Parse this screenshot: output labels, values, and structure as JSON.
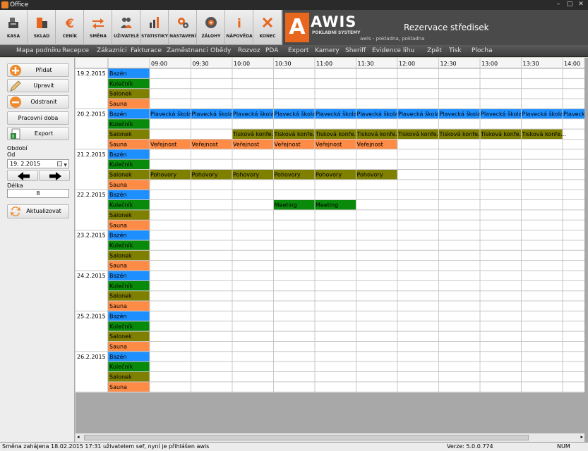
{
  "window": {
    "title": "Office"
  },
  "toolbar": [
    {
      "label": "KASA",
      "icon": "cash-register-icon"
    },
    {
      "label": "SKLAD",
      "icon": "warehouse-icon"
    },
    {
      "label": "CENÍK",
      "icon": "euro-icon"
    },
    {
      "label": "SMĚNA",
      "icon": "shift-arrows-icon"
    },
    {
      "label": "UŽIVATELÉ",
      "icon": "users-icon"
    },
    {
      "label": "STATISTIKY",
      "icon": "statistics-icon"
    },
    {
      "label": "NASTAVENÍ",
      "icon": "settings-icon"
    },
    {
      "label": "ZÁLOHY",
      "icon": "backup-icon"
    },
    {
      "label": "NÁPOVĚDA",
      "icon": "help-icon"
    },
    {
      "label": "KONEC",
      "icon": "close-icon"
    }
  ],
  "brand": {
    "name": "AWIS",
    "tagline": "POKLADNÍ SYSTÉMY",
    "page_title": "Rezervace středisek",
    "user_info": "awis  -  pokladna, pokladna"
  },
  "menu": [
    "Mapa podniku",
    "Recepce",
    "Zákazníci",
    "Fakturace",
    "Zaměstnanci",
    "Obědy",
    "Rozvoz",
    "PDA",
    "Export",
    "Kamery",
    "Sheriff",
    "Evidence lihu",
    "Zpět",
    "Tisk",
    "Plocha"
  ],
  "left_panel": {
    "add": "Přidat",
    "edit": "Upravit",
    "remove": "Odstranit",
    "work_hours": "Pracovní doba",
    "export": "Export",
    "period_label": "Období",
    "from_label": "Od",
    "from_value": "19.  2.2015",
    "length_label": "Délka",
    "length_value": "8",
    "refresh": "Aktualizovat"
  },
  "grid": {
    "times": [
      "09:00",
      "09:30",
      "10:00",
      "10:30",
      "11:00",
      "11:30",
      "12:00",
      "12:30",
      "13:00",
      "13:30",
      "14:00"
    ],
    "resources": [
      {
        "name": "Bazén",
        "color": "#1e8fff"
      },
      {
        "name": "Kulečník",
        "color": "#0a8a0a"
      },
      {
        "name": "Salonek",
        "color": "#7f7f00"
      },
      {
        "name": "Sauna",
        "color": "#ff8c46"
      }
    ],
    "days": [
      {
        "date": "19.2.2015",
        "rows": [
          [],
          [],
          [],
          []
        ]
      },
      {
        "date": "20.2.2015",
        "rows": [
          [
            "Plavecká škola",
            "Plavecká škola",
            "Plavecká škola",
            "Plavecká škola",
            "Plavecká škola",
            "Plavecká škola",
            "Plavecká škola",
            "Plavecká škola",
            "Plavecká škola",
            "Plavecká škola",
            "Plavecká škola"
          ],
          [],
          [
            "",
            "",
            "Tisková konfe…",
            "Tisková konfe…",
            "Tisková konfe…",
            "Tisková konfe…",
            "Tisková konfe…",
            "Tisková konfe…",
            "Tisková konfe…",
            "Tisková konfe…"
          ],
          [
            "Veřejnost",
            "Veřejnost",
            "Veřejnost",
            "Veřejnost",
            "Veřejnost",
            "Veřejnost"
          ]
        ]
      },
      {
        "date": "21.2.2015",
        "rows": [
          [],
          [],
          [
            "Pohovory",
            "Pohovory",
            "Pohovory",
            "Pohovory",
            "Pohovory",
            "Pohovory"
          ],
          []
        ]
      },
      {
        "date": "22.2.2015",
        "rows": [
          [],
          [
            "",
            "",
            "",
            "Meeting",
            "Meeting"
          ],
          [],
          []
        ]
      },
      {
        "date": "23.2.2015",
        "rows": [
          [],
          [],
          [],
          []
        ]
      },
      {
        "date": "24.2.2015",
        "rows": [
          [],
          [],
          [],
          []
        ]
      },
      {
        "date": "25.2.2015",
        "rows": [
          [],
          [],
          [],
          []
        ]
      },
      {
        "date": "26.2.2015",
        "rows": [
          [],
          [],
          [],
          []
        ]
      }
    ]
  },
  "status": {
    "left": "Směna zahájena 18.02.2015 17:31 uživatelem sef, nyní je přihlášen awis",
    "version": "Verze: 5.0.0.774",
    "num": "NUM"
  }
}
